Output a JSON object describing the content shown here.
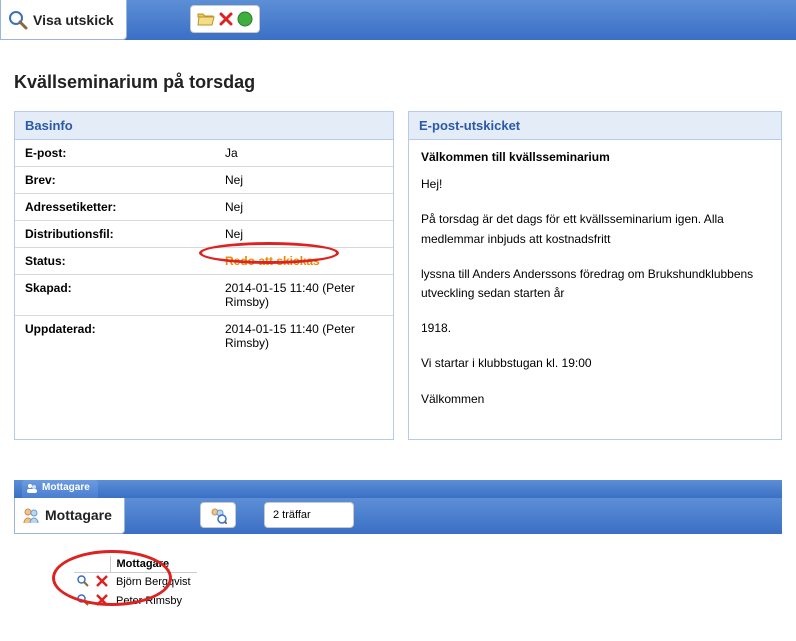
{
  "top": {
    "title": "Visa utskick"
  },
  "page_title": "Kvällseminarium på torsdag",
  "basinfo": {
    "header": "Basinfo",
    "rows": {
      "epost_label": "E-post:",
      "epost_value": "Ja",
      "brev_label": "Brev:",
      "brev_value": "Nej",
      "adress_label": "Adressetiketter:",
      "adress_value": "Nej",
      "dist_label": "Distributionsfil:",
      "dist_value": "Nej",
      "status_label": "Status:",
      "status_value": "Redo att skickas",
      "skapad_label": "Skapad:",
      "skapad_value": "2014-01-15 11:40 (Peter Rimsby)",
      "upd_label": "Uppdaterad:",
      "upd_value": "2014-01-15 11:40 (Peter Rimsby)"
    }
  },
  "email": {
    "header": "E-post-utskicket",
    "subject": "Välkommen till kvällsseminarium",
    "p1": "Hej!",
    "p2": "På torsdag är det dags för ett kvällsseminarium igen. Alla medlemmar inbjuds att kostnadsfritt",
    "p3": "lyssna till Anders Anderssons föredrag om Brukshundklubbens utveckling sedan starten år",
    "p4": "1918.",
    "p5": "Vi startar i klubbstugan kl. 19:00",
    "p6": "Välkommen"
  },
  "mottagare": {
    "tab_label": "Mottagare",
    "title": "Mottagare",
    "count": "2 träffar",
    "col_header": "Mottagare",
    "rows": [
      "Björn Bergqvist",
      "Peter Rimsby"
    ]
  }
}
